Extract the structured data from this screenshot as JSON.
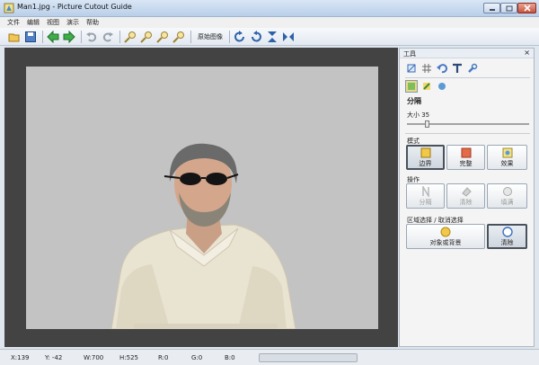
{
  "window": {
    "title": "Man1.jpg - Picture Cutout Guide"
  },
  "menu": [
    "文件",
    "编辑",
    "视图",
    "演示",
    "帮助"
  ],
  "toolbar": {
    "original_image_label": "原始图像"
  },
  "panel": {
    "title": "工具",
    "section_title": "分隔",
    "size_label": "大小 35",
    "size_value": 35,
    "mode": {
      "title": "模式",
      "buttons": [
        {
          "label": "边界",
          "selected": true
        },
        {
          "label": "完整",
          "selected": false
        },
        {
          "label": "效果",
          "selected": false
        }
      ]
    },
    "operation": {
      "title": "操作",
      "buttons": [
        {
          "label": "分隔"
        },
        {
          "label": "清除"
        },
        {
          "label": "填满"
        }
      ]
    },
    "region": {
      "title": "区域选择 / 取消选择",
      "object_label": "对象或背景",
      "clear_label": "清除"
    }
  },
  "status": {
    "x": "X:139",
    "y": "Y: -42",
    "w": "W:700",
    "h": "H:525",
    "r": "R:0",
    "g": "G:0",
    "b": "B:0"
  },
  "colors": {
    "canvas_bg": "#434343",
    "image_bg": "#c3c3c3",
    "selection_accent": "#e8d88a"
  }
}
